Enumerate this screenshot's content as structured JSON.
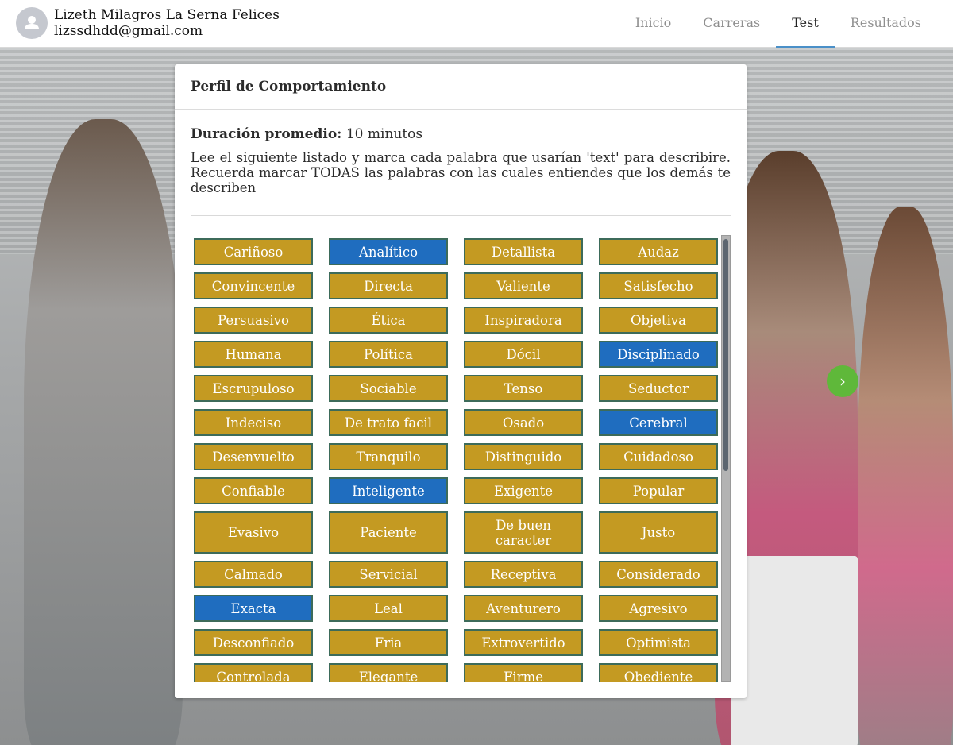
{
  "user": {
    "name": "Lizeth Milagros La Serna Felices",
    "email": "lizssdhdd@gmail.com",
    "avatar_icon": "user-silhouette-icon"
  },
  "nav": {
    "items": [
      {
        "label": "Inicio",
        "active": false
      },
      {
        "label": "Carreras",
        "active": false
      },
      {
        "label": "Test",
        "active": true
      },
      {
        "label": "Resultados",
        "active": false
      }
    ]
  },
  "card": {
    "title": "Perfil de Comportamiento",
    "duration_label": "Duración promedio:",
    "duration_value": "10 minutos",
    "instructions": "Lee el siguiente listado y marca cada palabra que usarían 'text' para describire. Recuerda marcar TODAS las palabras con las cuales entiendes que los demás te describen"
  },
  "words": [
    {
      "label": "Cariñoso",
      "selected": false
    },
    {
      "label": "Analítico",
      "selected": true
    },
    {
      "label": "Detallista",
      "selected": false
    },
    {
      "label": "Audaz",
      "selected": false
    },
    {
      "label": "Convincente",
      "selected": false
    },
    {
      "label": "Directa",
      "selected": false
    },
    {
      "label": "Valiente",
      "selected": false
    },
    {
      "label": "Satisfecho",
      "selected": false
    },
    {
      "label": "Persuasivo",
      "selected": false
    },
    {
      "label": "Ética",
      "selected": false
    },
    {
      "label": "Inspiradora",
      "selected": false
    },
    {
      "label": "Objetiva",
      "selected": false
    },
    {
      "label": "Humana",
      "selected": false
    },
    {
      "label": "Política",
      "selected": false
    },
    {
      "label": "Dócil",
      "selected": false
    },
    {
      "label": "Disciplinado",
      "selected": true
    },
    {
      "label": "Escrupuloso",
      "selected": false
    },
    {
      "label": "Sociable",
      "selected": false
    },
    {
      "label": "Tenso",
      "selected": false
    },
    {
      "label": "Seductor",
      "selected": false
    },
    {
      "label": "Indeciso",
      "selected": false
    },
    {
      "label": "De trato facil",
      "selected": false
    },
    {
      "label": "Osado",
      "selected": false
    },
    {
      "label": "Cerebral",
      "selected": true
    },
    {
      "label": "Desenvuelto",
      "selected": false
    },
    {
      "label": "Tranquilo",
      "selected": false
    },
    {
      "label": "Distinguido",
      "selected": false
    },
    {
      "label": "Cuidadoso",
      "selected": false
    },
    {
      "label": "Confiable",
      "selected": false
    },
    {
      "label": "Inteligente",
      "selected": true
    },
    {
      "label": "Exigente",
      "selected": false
    },
    {
      "label": "Popular",
      "selected": false
    },
    {
      "label": "Evasivo",
      "selected": false,
      "tall": true
    },
    {
      "label": "Paciente",
      "selected": false,
      "tall": true
    },
    {
      "label": "De buen caracter",
      "selected": false,
      "tall": true
    },
    {
      "label": "Justo",
      "selected": false,
      "tall": true
    },
    {
      "label": "Calmado",
      "selected": false
    },
    {
      "label": "Servicial",
      "selected": false
    },
    {
      "label": "Receptiva",
      "selected": false
    },
    {
      "label": "Considerado",
      "selected": false
    },
    {
      "label": "Exacta",
      "selected": true
    },
    {
      "label": "Leal",
      "selected": false
    },
    {
      "label": "Aventurero",
      "selected": false
    },
    {
      "label": "Agresivo",
      "selected": false
    },
    {
      "label": "Desconfiado",
      "selected": false
    },
    {
      "label": "Fria",
      "selected": false
    },
    {
      "label": "Extrovertido",
      "selected": false
    },
    {
      "label": "Optimista",
      "selected": false
    },
    {
      "label": "Controlada",
      "selected": false
    },
    {
      "label": "Elegante",
      "selected": false
    },
    {
      "label": "Firme",
      "selected": false
    },
    {
      "label": "Obediente",
      "selected": false
    }
  ],
  "colors": {
    "word_unselected": "#c49a22",
    "word_selected": "#1f6dbf",
    "word_border": "#3d6b5a",
    "next_button": "#5fb83a",
    "nav_active_underline": "#4a90c8"
  },
  "next_button": {
    "icon": "chevron-right-icon",
    "glyph": "›"
  }
}
